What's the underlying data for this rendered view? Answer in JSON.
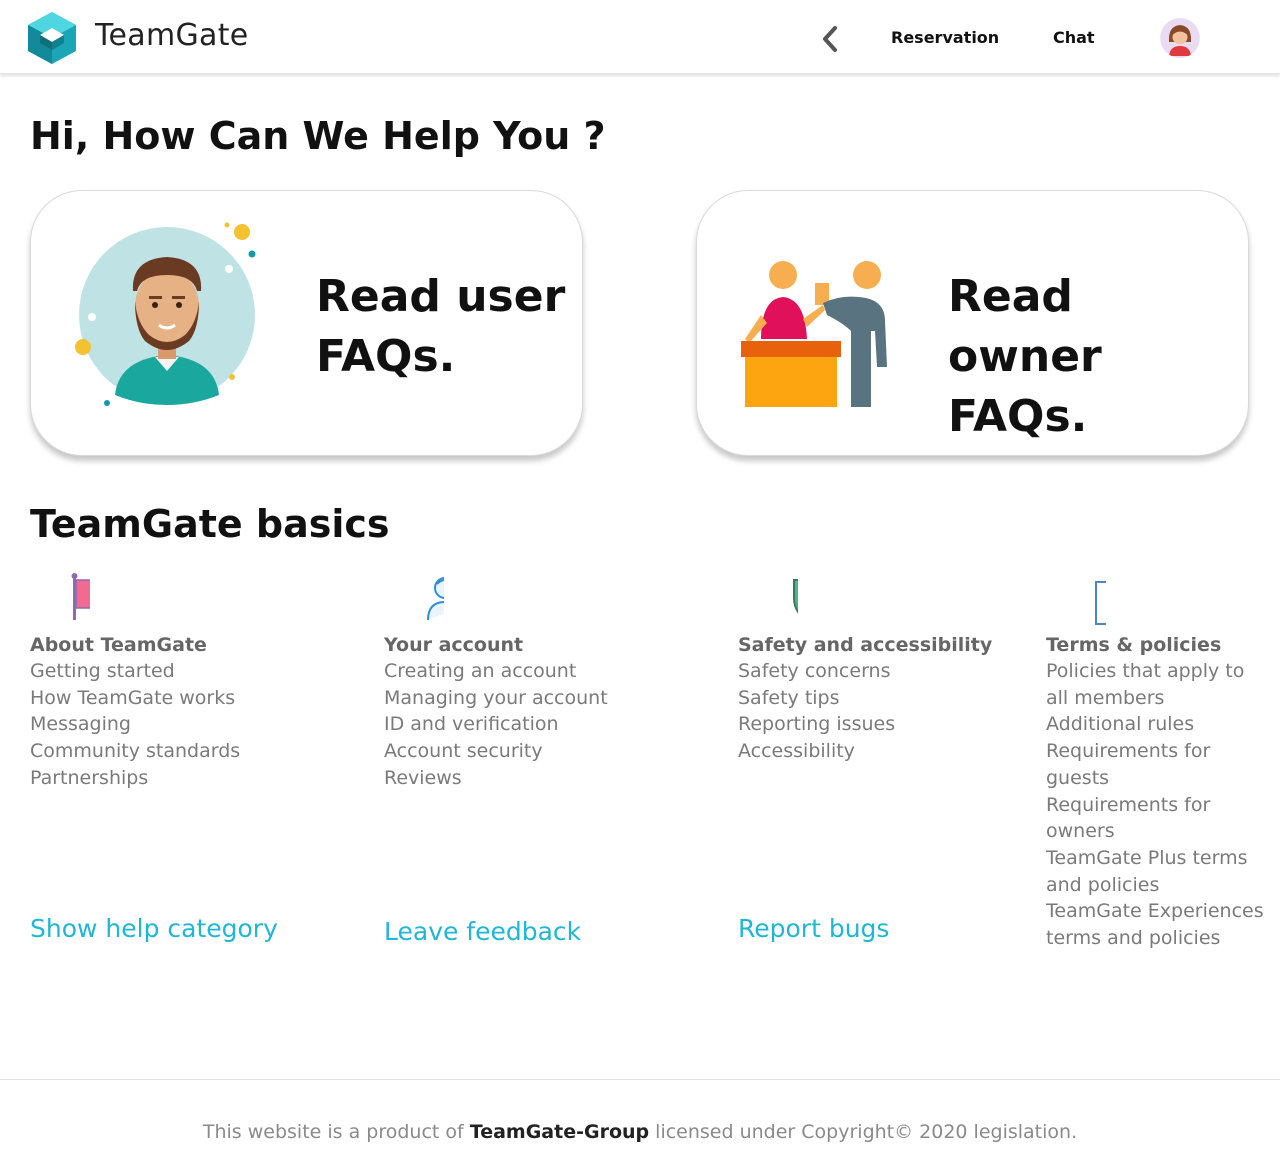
{
  "header": {
    "brand": "TeamGate",
    "nav": {
      "reservation": "Reservation",
      "chat": "Chat"
    },
    "icons": {
      "logo": "teamgate-logo-icon",
      "back": "chevron-left-icon",
      "avatar": "user-avatar-icon"
    }
  },
  "main": {
    "title": "Hi, How Can We Help You ?",
    "cards": {
      "user": {
        "label": "Read user FAQs.",
        "icon": "user-portrait-illustration"
      },
      "owner": {
        "label": "Read owner FAQs.",
        "icon": "reception-desk-illustration"
      }
    }
  },
  "basics": {
    "title": "TeamGate basics",
    "columns": [
      {
        "title": "About TeamGate",
        "icon": "flag-icon",
        "items": [
          "Getting started",
          "How TeamGate works",
          "Messaging",
          "Community standards",
          "Partnerships"
        ]
      },
      {
        "title": "Your account",
        "icon": "user-edit-icon",
        "items": [
          "Creating an account",
          "Managing your account",
          "ID and verification",
          "Account security",
          "Reviews"
        ]
      },
      {
        "title": "Safety and accessibility",
        "icon": "shield-check-icon",
        "items": [
          "Safety concerns",
          "Safety tips",
          "Reporting issues",
          "Accessibility"
        ]
      },
      {
        "title": "Terms & policies",
        "icon": "book-bookmark-icon",
        "items": [
          "Policies that apply to all members",
          "Additional rules",
          "Requirements for guests",
          "Requirements for owners",
          "TeamGate Plus terms and policies",
          "TeamGate Experiences terms and policies"
        ]
      }
    ],
    "links": {
      "help": "Show help category",
      "feedback": "Leave feedback",
      "bugs": "Report bugs"
    }
  },
  "footer": {
    "prefix": "This website is a product of",
    "company": "TeamGate-Group",
    "suffix": "licensed under Copyright© 2020 legislation."
  },
  "colors": {
    "accent": "#1fb6d8",
    "logo_teal": "#17a6b8",
    "text_gray": "#7a7a7a"
  }
}
